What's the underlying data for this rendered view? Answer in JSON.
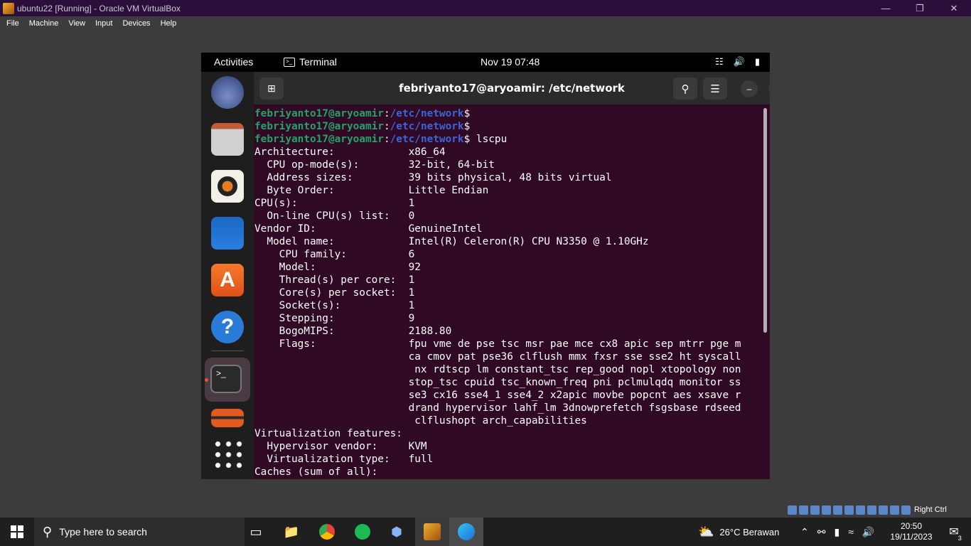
{
  "window": {
    "title": "ubuntu22 [Running] - Oracle VM VirtualBox"
  },
  "menu": [
    "File",
    "Machine",
    "View",
    "Input",
    "Devices",
    "Help"
  ],
  "gnome": {
    "activities": "Activities",
    "app": "Terminal",
    "clock": "Nov 19  07:48"
  },
  "terminal": {
    "title": "febriyanto17@aryoamir: /etc/network",
    "lines": [
      {
        "user": "febriyanto17@aryoamir",
        "sep": ":",
        "path": "/etc/network",
        "cmd": "$"
      },
      {
        "user": "febriyanto17@aryoamir",
        "sep": ":",
        "path": "/etc/network",
        "cmd": "$"
      },
      {
        "user": "febriyanto17@aryoamir",
        "sep": ":",
        "path": "/etc/network",
        "cmd": "$ lscpu"
      },
      {
        "text": "Architecture:            x86_64"
      },
      {
        "text": "  CPU op-mode(s):        32-bit, 64-bit"
      },
      {
        "text": "  Address sizes:         39 bits physical, 48 bits virtual"
      },
      {
        "text": "  Byte Order:            Little Endian"
      },
      {
        "text": "CPU(s):                  1"
      },
      {
        "text": "  On-line CPU(s) list:   0"
      },
      {
        "text": "Vendor ID:               GenuineIntel"
      },
      {
        "text": "  Model name:            Intel(R) Celeron(R) CPU N3350 @ 1.10GHz"
      },
      {
        "text": "    CPU family:          6"
      },
      {
        "text": "    Model:               92"
      },
      {
        "text": "    Thread(s) per core:  1"
      },
      {
        "text": "    Core(s) per socket:  1"
      },
      {
        "text": "    Socket(s):           1"
      },
      {
        "text": "    Stepping:            9"
      },
      {
        "text": "    BogoMIPS:            2188.80"
      },
      {
        "text": "    Flags:               fpu vme de pse tsc msr pae mce cx8 apic sep mtrr pge m"
      },
      {
        "text": "                         ca cmov pat pse36 clflush mmx fxsr sse sse2 ht syscall"
      },
      {
        "text": "                          nx rdtscp lm constant_tsc rep_good nopl xtopology non"
      },
      {
        "text": "                         stop_tsc cpuid tsc_known_freq pni pclmulqdq monitor ss"
      },
      {
        "text": "                         se3 cx16 sse4_1 sse4_2 x2apic movbe popcnt aes xsave r"
      },
      {
        "text": "                         drand hypervisor lahf_lm 3dnowprefetch fsgsbase rdseed"
      },
      {
        "text": "                          clflushopt arch_capabilities"
      },
      {
        "text": "Virtualization features:"
      },
      {
        "text": "  Hypervisor vendor:     KVM"
      },
      {
        "text": "  Virtualization type:   full"
      },
      {
        "text": "Caches (sum of all):"
      }
    ]
  },
  "vbox_status": {
    "host_key": "Right Ctrl"
  },
  "taskbar": {
    "search_placeholder": "Type here to search",
    "weather": "26°C  Berawan",
    "time": "20:50",
    "date": "19/11/2023",
    "notifications": "3"
  }
}
